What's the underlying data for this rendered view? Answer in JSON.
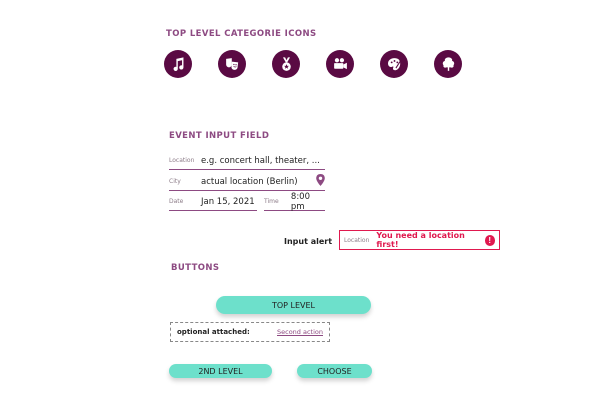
{
  "categories": {
    "title": "TOP LEVEL CATEGORIE ICONS",
    "icons": [
      "music-icon",
      "theater-masks-icon",
      "award-medal-icon",
      "film-camera-icon",
      "art-palette-icon",
      "tree-icon"
    ],
    "color": "#5a0a43"
  },
  "event_input": {
    "title": "EVENT INPUT FIELD",
    "location_label": "Location",
    "location_placeholder": "e.g. concert hall, theater, ...",
    "city_label": "City",
    "city_value": "actual location (Berlin)",
    "date_label": "Date",
    "date_value": "Jan 15, 2021",
    "time_label": "Time",
    "time_value": "8:00 pm"
  },
  "alert": {
    "caption": "Input alert",
    "field_label": "Location",
    "message": "You need a location first!",
    "color": "#e0194f"
  },
  "buttons": {
    "title": "BUTTONS",
    "top_level": "TOP LEVEL",
    "optional_label": "optional attached:",
    "second_action": "Second action",
    "second_level": "2ND LEVEL",
    "choose": "CHOOSE",
    "accent": "#6de0cb"
  }
}
